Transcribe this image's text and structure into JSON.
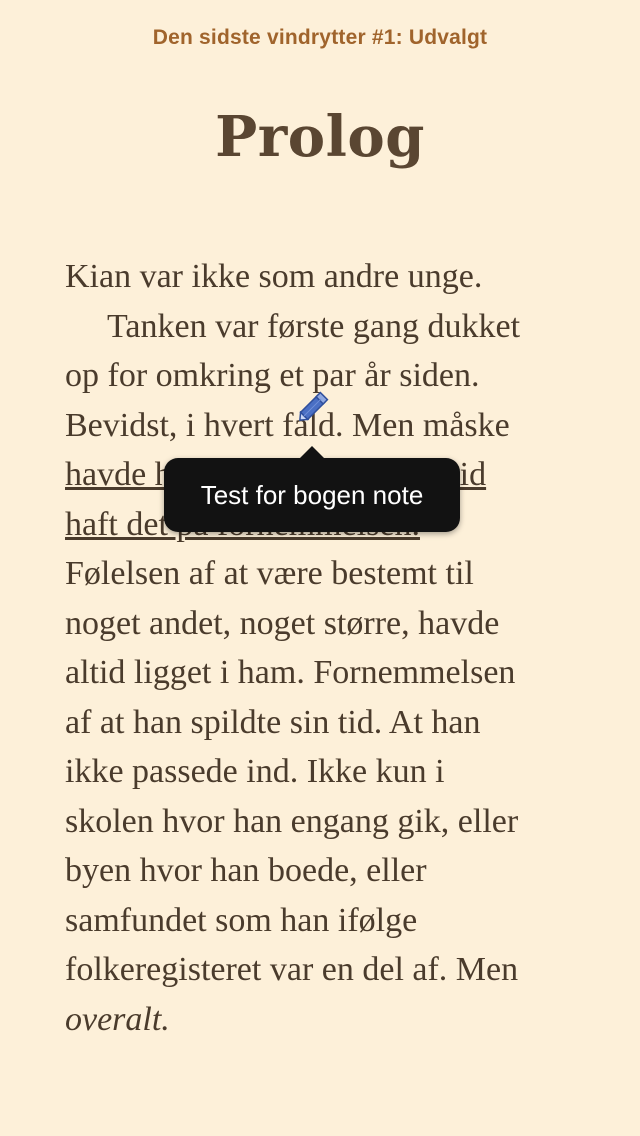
{
  "header": {
    "book_title": "Den sidste vindrytter #1: Udvalgt"
  },
  "chapter": {
    "title": "Prolog"
  },
  "page": {
    "lines": [
      "Kian var ikke som andre unge.",
      "Tanken var første gang dukket",
      "op for omkring et par år siden.",
      "Bevidst, i hvert fald. Men måske",
      "havde han i virkeligheden altid",
      "haft det på fornemmelsen.",
      "Følelsen af at være bestemt til",
      "noget andet, noget større, havde",
      "altid ligget i ham. Fornemmelsen",
      "af at han spildte sin tid. At han",
      "ikke passede ind. Ikke kun i",
      "skolen hvor han engang gik, eller",
      "byen hvor han boede, eller",
      "samfundet som han ifølge",
      "folkeregisteret var en del af. Men",
      "overalt."
    ]
  },
  "note": {
    "text": "Test for bogen note",
    "icon": "pencil-icon",
    "icon_color": "#4a6fc4"
  },
  "colors": {
    "background": "#fdf0d9",
    "book_title": "#a0642c",
    "chapter_title": "#5a4632",
    "body_text": "#4a3b2c"
  }
}
